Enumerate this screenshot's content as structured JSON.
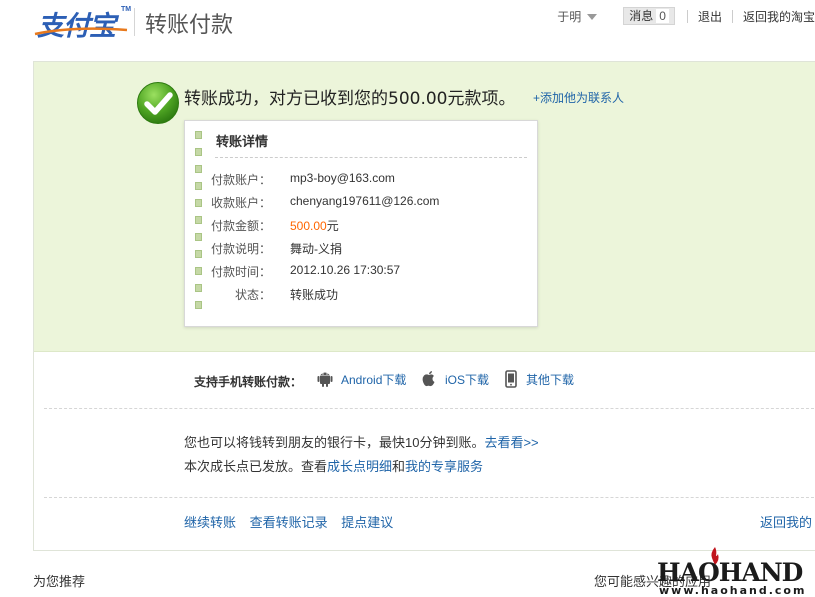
{
  "header": {
    "logo_text": "支付宝",
    "logo_tm": "TM",
    "page_title": "转账付款",
    "user_name": "于明",
    "messages_label": "消息",
    "messages_count": "0",
    "logout_label": "退出",
    "return_label": "返回我的淘宝"
  },
  "success": {
    "message": "转账成功，对方已收到您的500.00元款项。",
    "add_contact": "+添加他为联系人"
  },
  "details": {
    "title": "转账详情",
    "rows": [
      {
        "label": "付款账户：",
        "value": "mp3-boy@163.com"
      },
      {
        "label": "收款账户：",
        "value": "chenyang197611@126.com"
      },
      {
        "label": "付款金额：",
        "value": "500.00",
        "suffix": "元"
      },
      {
        "label": "付款说明：",
        "value": "舞动-义捐"
      },
      {
        "label": "付款时间：",
        "value": "2012.10.26 17:30:57"
      },
      {
        "label": "状态：",
        "value": "转账成功"
      }
    ]
  },
  "mobile": {
    "label": "支持手机转账付款：",
    "android": "Android下载",
    "ios": "iOS下载",
    "other": "其他下载"
  },
  "info": {
    "line1_text": "您也可以将钱转到朋友的银行卡，最快10分钟到账。",
    "line1_link": "去看看>>",
    "line2_prefix": "本次成长点已发放。查看",
    "line2_link1": "成长点明细",
    "line2_and": "和",
    "line2_link2": "我的专享服务"
  },
  "actions": {
    "continue": "继续转账",
    "records": "查看转账记录",
    "suggest": "提点建议",
    "return": "返回我的"
  },
  "bottom": {
    "recommend_title": "为您推荐",
    "interest_title": "您可能感兴趣的应用"
  },
  "watermark": {
    "big": "HAOHAND",
    "small": "www.haohand.com"
  },
  "colors": {
    "link": "#1f64a8",
    "success_bg": "#ecf5da",
    "amount": "#ff6600",
    "check_green": "#5aa92c"
  }
}
